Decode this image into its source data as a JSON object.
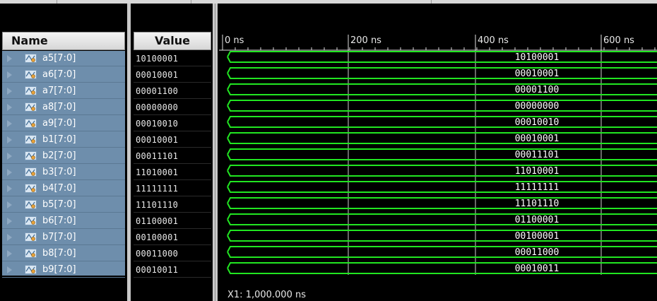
{
  "columns": {
    "name_header": "Name",
    "value_header": "Value"
  },
  "timeline": {
    "ticks": [
      "0 ns",
      "200 ns",
      "400 ns",
      "600 ns"
    ]
  },
  "cursor": {
    "readout": "X1: 1,000.000 ns"
  },
  "colors": {
    "waveform": "#21e621",
    "name_panel": "#6e8eac",
    "background": "#000000"
  },
  "signals": [
    {
      "name": "a5[7:0]",
      "value": "10100001"
    },
    {
      "name": "a6[7:0]",
      "value": "00010001"
    },
    {
      "name": "a7[7:0]",
      "value": "00001100"
    },
    {
      "name": "a8[7:0]",
      "value": "00000000"
    },
    {
      "name": "a9[7:0]",
      "value": "00010010"
    },
    {
      "name": "b1[7:0]",
      "value": "00010001"
    },
    {
      "name": "b2[7:0]",
      "value": "00011101"
    },
    {
      "name": "b3[7:0]",
      "value": "11010001"
    },
    {
      "name": "b4[7:0]",
      "value": "11111111"
    },
    {
      "name": "b5[7:0]",
      "value": "11101110"
    },
    {
      "name": "b6[7:0]",
      "value": "01100001"
    },
    {
      "name": "b7[7:0]",
      "value": "00100001"
    },
    {
      "name": "b8[7:0]",
      "value": "00011000"
    },
    {
      "name": "b9[7:0]",
      "value": "00010011"
    }
  ]
}
